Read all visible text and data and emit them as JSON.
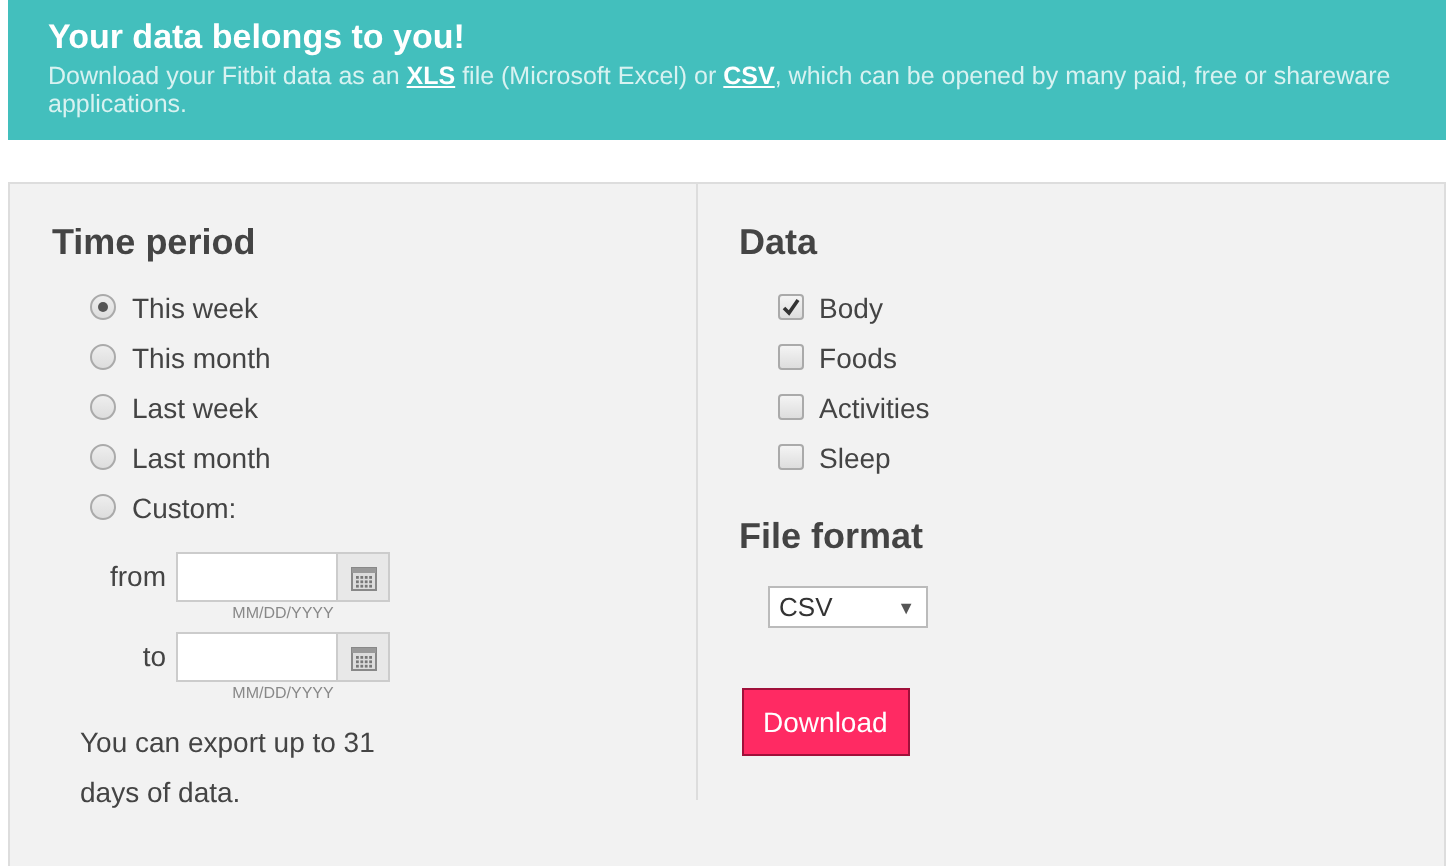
{
  "banner": {
    "title": "Your data belongs to you!",
    "description": [
      {
        "kind": "text",
        "text": "Download your Fitbit data as an "
      },
      {
        "kind": "link",
        "text": "XLS"
      },
      {
        "kind": "text",
        "text": " file (Microsoft Excel) or "
      },
      {
        "kind": "link",
        "text": "CSV"
      },
      {
        "kind": "text",
        "text": ", which can be opened by many paid, free or shareware applications."
      }
    ]
  },
  "time_period": {
    "heading": "Time period",
    "options": [
      {
        "label": "This week",
        "selected": true
      },
      {
        "label": "This month",
        "selected": false
      },
      {
        "label": "Last week",
        "selected": false
      },
      {
        "label": "Last month",
        "selected": false
      },
      {
        "label": "Custom:",
        "selected": false
      }
    ],
    "date_fields": [
      {
        "label": "from",
        "hint": "MM/DD/YYYY"
      },
      {
        "label": "to",
        "hint": "MM/DD/YYYY"
      }
    ],
    "note": "You can export up to 31 days of data."
  },
  "data": {
    "heading": "Data",
    "options": [
      {
        "label": "Body",
        "checked": true
      },
      {
        "label": "Foods",
        "checked": false
      },
      {
        "label": "Activities",
        "checked": false
      },
      {
        "label": "Sleep",
        "checked": false
      }
    ]
  },
  "file_format": {
    "heading": "File format",
    "value": "CSV",
    "caret": "▼"
  },
  "download_button": "Download"
}
